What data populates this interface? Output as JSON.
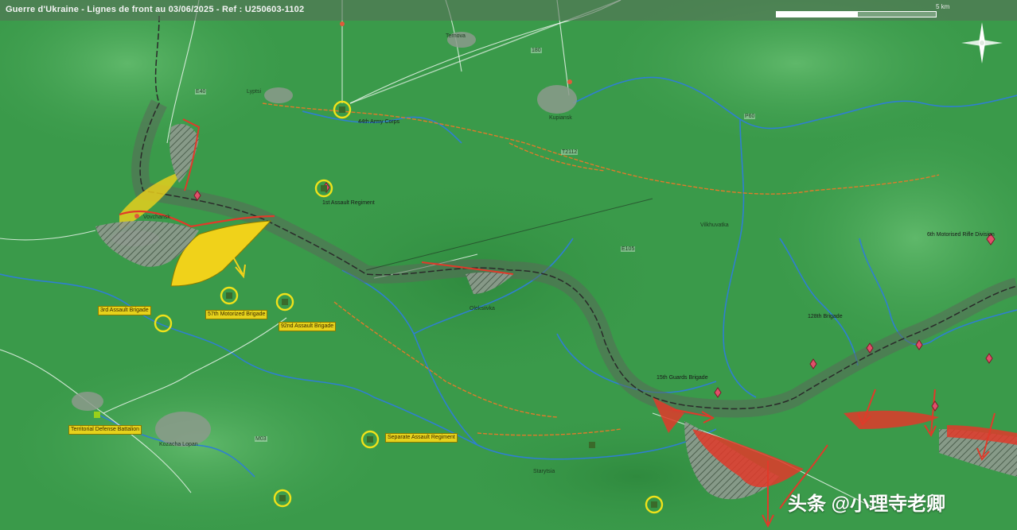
{
  "header": {
    "title": "Guerre d'Ukraine - Lignes de front au 03/06/2025 - Ref : U250603-1102",
    "scale_label": "5 km"
  },
  "compass": {
    "icon": "north-arrow-compass-icon"
  },
  "colors": {
    "map_green": "#3a9a4a",
    "river": "#2f7fd1",
    "road": "#e07a2a",
    "frontline": "#2a2a2a",
    "ru_advance": "#e03a2a",
    "ua_zone": "#f0d21a"
  },
  "places": [
    "Vovchansk",
    "Lyptsi",
    "Ternova",
    "Kozacha Lopan",
    "Kupiansk",
    "Oleksiivka",
    "Vilkhuvatka",
    "Starytsia"
  ],
  "road_numbers": [
    "E40",
    "T2112",
    "P60",
    "M03",
    "E105",
    "180"
  ],
  "units": {
    "ua_units": [
      "3rd Assault Brigade",
      "57th Motorized Brigade",
      "92nd Assault Brigade",
      "Territorial Defense Battalion",
      "Separate Assault Regiment"
    ],
    "ru_units": [
      "1st Assault Regiment",
      "44th Army Corps",
      "6th Motorised Rifle Division",
      "128th Brigade",
      "15th Guards Brigade"
    ]
  },
  "watermark": "头条 @小理寺老卿"
}
